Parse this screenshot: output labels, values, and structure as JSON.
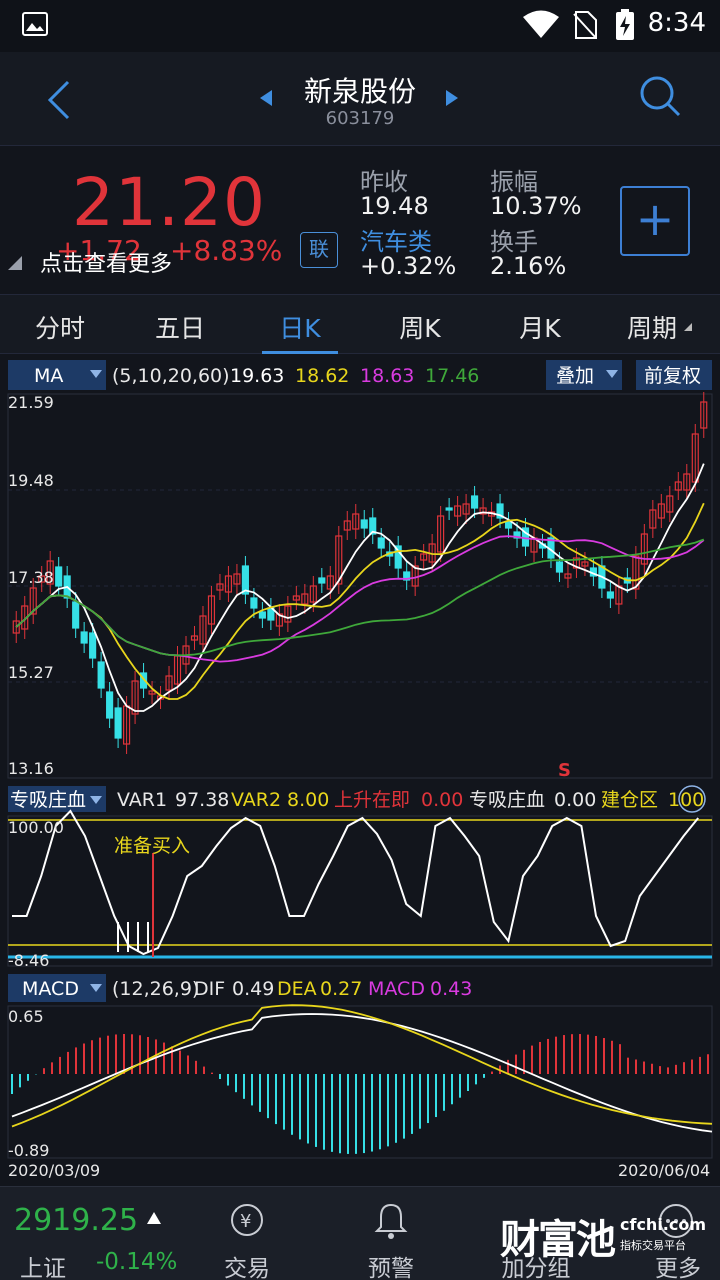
{
  "status_bar": {
    "time": "8:34"
  },
  "header": {
    "name": "新泉股份",
    "code": "603179"
  },
  "quote": {
    "price": "21.20",
    "change": "+1.72",
    "change_pct": "+8.83%",
    "more_hint": "点击查看更多",
    "lian": "联",
    "prev_close_label": "昨收",
    "prev_close": "19.48",
    "amplitude_label": "振幅",
    "amplitude": "10.37%",
    "sector_label": "汽车类",
    "sector_change": "+0.32%",
    "turnover_label": "换手",
    "turnover": "2.16%",
    "add_button": "+"
  },
  "tabs": [
    {
      "label": "分时"
    },
    {
      "label": "五日"
    },
    {
      "label": "日K"
    },
    {
      "label": "周K"
    },
    {
      "label": "月K"
    },
    {
      "label": "周期"
    }
  ],
  "active_tab": "日K",
  "ma_bar": {
    "selector": "MA",
    "params": "(5,10,20,60)",
    "ma5": "19.63",
    "ma10": "18.62",
    "ma20": "18.63",
    "ma60": "17.46",
    "overlay": "叠加",
    "adjust": "前复权"
  },
  "ind_bar": {
    "selector": "专吸庄血",
    "var1_label": "VAR1",
    "var1": "97.38",
    "var2_label": "VAR2",
    "var2": "8.00",
    "rise_label": "上升在即",
    "rise": "0.00",
    "zxzx_label": "专吸庄血",
    "zxzx": "0.00",
    "build_label": "建仓区",
    "build": "100"
  },
  "macd_bar": {
    "selector": "MACD",
    "params": "(12,26,9)",
    "dif_label": "DIF",
    "dif": "0.49",
    "dea_label": "DEA",
    "dea": "0.27",
    "macd_label": "MACD",
    "macd": "0.43"
  },
  "chart_data": [
    {
      "type": "candlestick",
      "y_ticks": [
        "21.59",
        "19.48",
        "17.38",
        "15.27",
        "13.16"
      ],
      "ylim": [
        13.16,
        21.59
      ],
      "marker": "S",
      "series": [
        {
          "name": "MA5",
          "color": "#ffffff"
        },
        {
          "name": "MA10",
          "color": "#e8d61c"
        },
        {
          "name": "MA20",
          "color": "#d93be0"
        },
        {
          "name": "MA60",
          "color": "#3fa83a"
        }
      ]
    },
    {
      "type": "line",
      "y_ticks": [
        "100.00",
        "-8.46"
      ],
      "ylim": [
        -8.46,
        100
      ],
      "annotation": "准备买入"
    },
    {
      "type": "bar",
      "y_ticks": [
        "0.65",
        "-0.89"
      ],
      "ylim": [
        -0.89,
        0.65
      ],
      "x_start": "2020/03/09",
      "x_end": "2020/06/04"
    }
  ],
  "bottom_nav": {
    "index_value": "2919.25",
    "index_name": "上证",
    "index_change": "-0.14%",
    "items": [
      {
        "label": "交易"
      },
      {
        "label": "预警"
      },
      {
        "label": "加分组"
      },
      {
        "label": "更多"
      }
    ],
    "watermark": "财富池",
    "watermark_url": "cfchi.com",
    "watermark_sub": "指标交易平台"
  }
}
